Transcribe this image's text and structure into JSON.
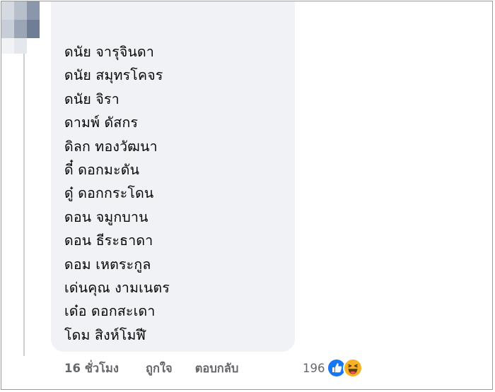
{
  "comment": {
    "author_name": "",
    "lines": [
      "ดนัย จารุจินดา",
      "ดนัย สมุทรโคจร",
      "ดนัย จิรา",
      "ดามพ์ ดัสกร",
      "ดิลก ทองวัฒนา",
      "ดี๋ ดอกมะดัน",
      "ดู๋ ดอกกระโดน",
      "ดอน จมูกบาน",
      "ดอน ธีระธาดา",
      "ดอม เหตระกูล",
      "เด่นคุณ งามเนตร",
      "เด๋อ ดอกสะเดา",
      "โดม สิงห์โมฬี"
    ]
  },
  "actions": {
    "time": "16 ชั่วโมง",
    "like": "ถูกใจ",
    "reply": "ตอบกลับ"
  },
  "reactions": {
    "count": "196",
    "icons": [
      "like-reaction-icon",
      "haha-reaction-icon"
    ],
    "colors": {
      "like": "#1877f2",
      "haha": "#f7b125"
    }
  },
  "colors": {
    "bubble": "#f0f2f5",
    "text": "#050505",
    "meta": "#65676b"
  }
}
